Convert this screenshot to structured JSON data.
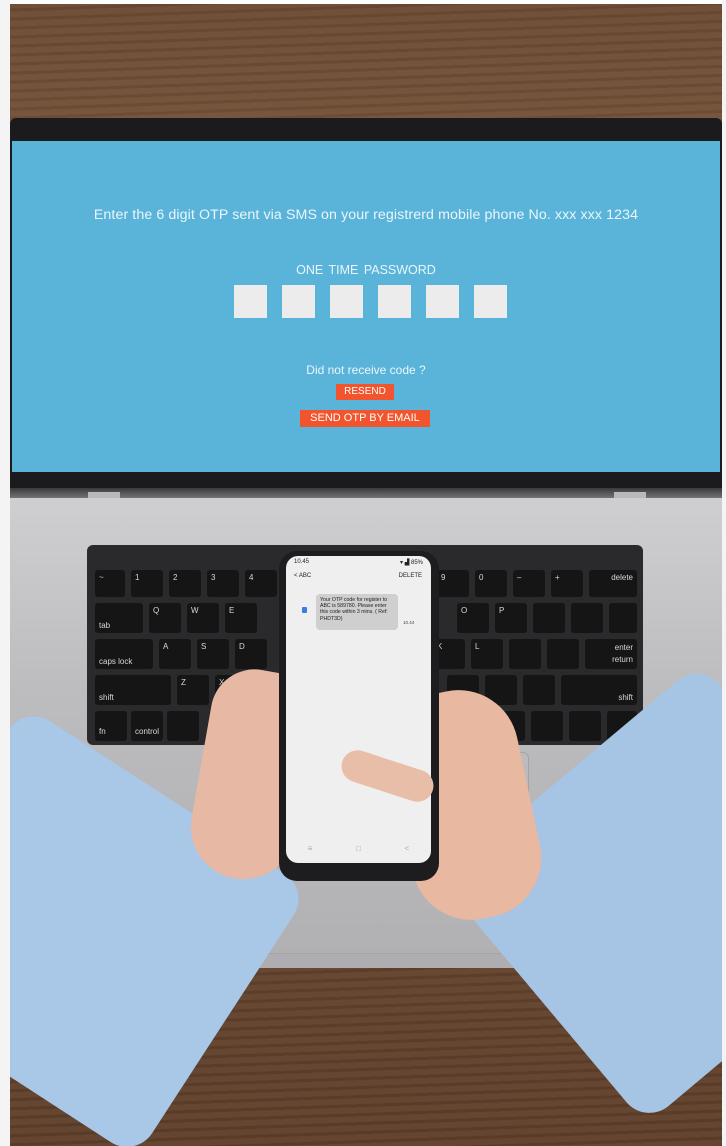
{
  "laptop_screen": {
    "instruction": "Enter the 6 digit OTP sent via SMS on your registrerd mobile phone No. xxx xxx 1234",
    "otp_title": "ONE  TIME  PASSWORD",
    "otp_boxes": [
      "",
      "",
      "",
      "",
      "",
      ""
    ],
    "not_received": "Did not receive code ?",
    "resend_label": "RESEND",
    "email_label": "SEND OTP BY EMAIL",
    "accent_color": "#f2542d",
    "background_color": "#5ab4d9"
  },
  "keyboard": {
    "keys": {
      "tab": "tab",
      "caps": "caps lock",
      "shift_l": "shift",
      "shift_r": "shift",
      "fn": "fn",
      "control": "control",
      "delete": "delete",
      "enter": "enter",
      "return": "return",
      "q": "Q",
      "w": "W",
      "e": "E",
      "a": "A",
      "s": "S",
      "d": "D",
      "z": "Z",
      "x": "X",
      "o": "O",
      "p": "P",
      "k": "K",
      "l": "L",
      "n9": "9",
      "n0": "0",
      "n1": "1",
      "n2": "2",
      "n3": "3",
      "n4": "4",
      "tilde": "~",
      "minus": "–",
      "plus": "+",
      "eq": "="
    }
  },
  "phone": {
    "time": "10.45",
    "battery": "85%",
    "back_label": "< ABC",
    "delete_label": "DELETE",
    "message": "Your OTP code for register to ABC is 589780. Please enter this code within 3 mins. ( Ref: PHDT3D)",
    "message_time": "10.44",
    "nav": [
      "≡",
      "□",
      "<"
    ]
  }
}
